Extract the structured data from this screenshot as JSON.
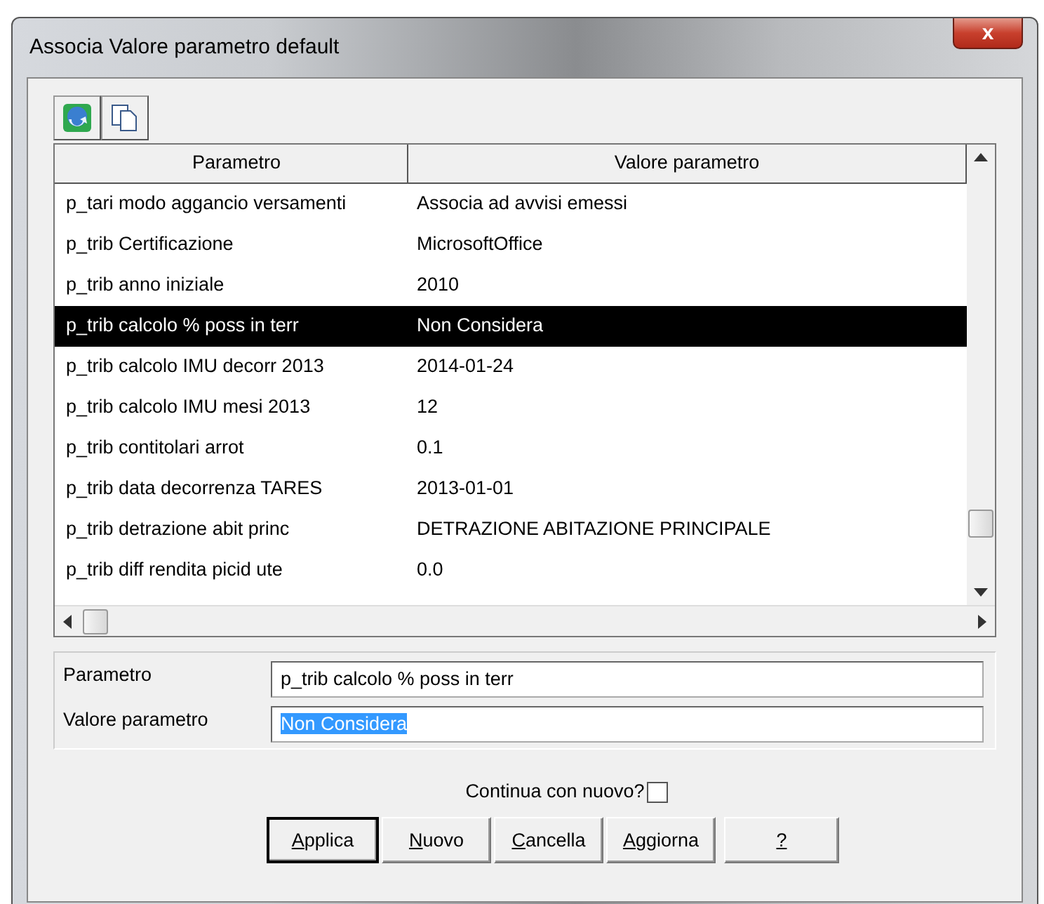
{
  "window": {
    "title": "Associa Valore parametro default",
    "close": "x"
  },
  "toolbar": [
    {
      "kind": "refresh"
    },
    {
      "kind": "copy"
    }
  ],
  "table": {
    "columns": [
      "Parametro",
      "Valore parametro"
    ],
    "rows": [
      {
        "cells": [
          "p_tari modo aggancio versamenti",
          "Associa ad avvisi emessi"
        ],
        "selected": false
      },
      {
        "cells": [
          "p_trib Certificazione",
          "MicrosoftOffice"
        ],
        "selected": false
      },
      {
        "cells": [
          "p_trib anno iniziale",
          "2010"
        ],
        "selected": false
      },
      {
        "cells": [
          "p_trib calcolo % poss in terr",
          "Non Considera"
        ],
        "selected": true
      },
      {
        "cells": [
          "p_trib calcolo IMU decorr 2013",
          "2014-01-24"
        ],
        "selected": false
      },
      {
        "cells": [
          "p_trib calcolo IMU mesi 2013",
          "12"
        ],
        "selected": false
      },
      {
        "cells": [
          "p_trib contitolari arrot",
          "0.1"
        ],
        "selected": false
      },
      {
        "cells": [
          "p_trib data decorrenza TARES",
          "2013-01-01"
        ],
        "selected": false
      },
      {
        "cells": [
          "p_trib detrazione abit princ",
          "DETRAZIONE ABITAZIONE PRINCIPALE"
        ],
        "selected": false
      },
      {
        "cells": [
          "p_trib diff rendita picid ute",
          "0.0"
        ],
        "selected": false
      }
    ]
  },
  "form": [
    {
      "label": "Parametro",
      "value": "p_trib calcolo % poss in terr",
      "highlighted": false
    },
    {
      "label": "Valore parametro",
      "value": "Non Considera",
      "highlighted": true
    }
  ],
  "continue_checkbox": {
    "label": "Continua con nuovo?",
    "checked": false
  },
  "buttons": [
    {
      "label": "Applica",
      "default": true
    },
    {
      "label": "Nuovo",
      "default": false
    },
    {
      "label": "Cancella",
      "default": false
    },
    {
      "label": "Aggiorna",
      "default": false
    },
    {
      "label": "?",
      "default": false
    }
  ]
}
